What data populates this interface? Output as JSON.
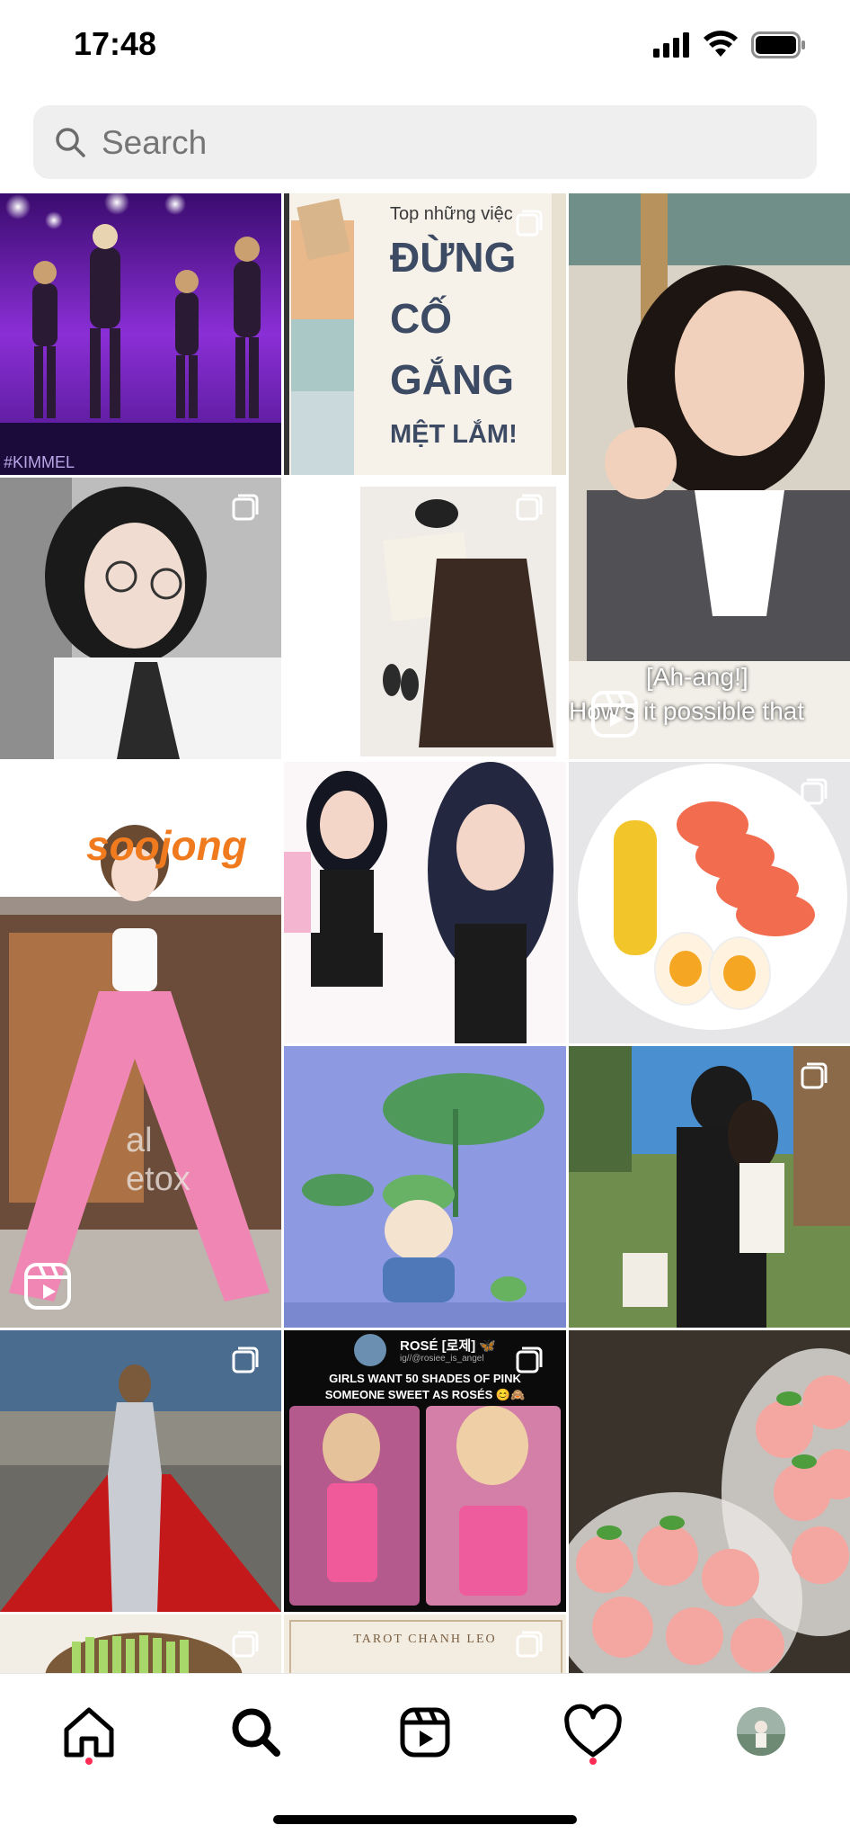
{
  "status_bar": {
    "time": "17:48"
  },
  "search": {
    "placeholder": "Search"
  },
  "tiles": {
    "motivation_top": "Top những việc",
    "motivation_line1": "ĐỪNG",
    "motivation_line2": "CỐ",
    "motivation_line3": "GẮNG",
    "motivation_line4": "MỆT LẮM!",
    "kimmel_watermark": "#KIMMEL",
    "store_sign": "soojong",
    "mural_text": "al etox",
    "video_caption_1": "[Ah-ang!]",
    "video_caption_2": "How's it possible that",
    "rose_name": "ROSÉ [로제] 🦋",
    "rose_handle": "ig//@rosiee_is_angel",
    "rose_text_1": "GIRLS WANT 50 SHADES OF PINK",
    "rose_text_2": "SOMEONE SWEET AS ROSÉS 😊🙈",
    "tarot_title": "TAROT CHANH LEO"
  },
  "tabbar": {
    "items": [
      "home",
      "search",
      "reels",
      "activity",
      "profile"
    ]
  },
  "colors": {
    "notification_dot": "#ff2d55",
    "search_bg": "#efefef"
  }
}
